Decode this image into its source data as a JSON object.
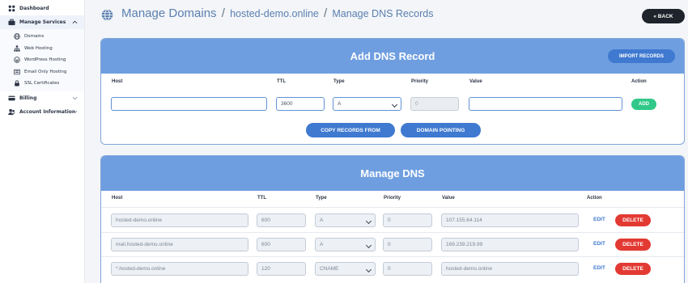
{
  "sidebar": {
    "dashboard": "Dashboard",
    "manage_services": "Manage Services",
    "sub_items": [
      "Domains",
      "Web Hosting",
      "WordPress Hosting",
      "Email Only Hosting",
      "SSL Certificates"
    ],
    "billing": "Billing",
    "account_information": "Account Information"
  },
  "header": {
    "title": "Manage Domains",
    "sep1": "/",
    "domain": "hosted-demo.online",
    "sep2": "/",
    "page": "Manage DNS Records",
    "back_label": "« BACK"
  },
  "add_card": {
    "title": "Add DNS Record",
    "import_label": "IMPORT RECORDS",
    "columns": [
      "Host",
      "TTL",
      "Type",
      "Priority",
      "Value",
      "Action"
    ],
    "ttl_value": "3600",
    "type_value": "A",
    "priority_value": "0",
    "add_label": "ADD",
    "copy_label": "COPY RECORDS FROM",
    "pointing_label": "DOMAIN POINTING"
  },
  "manage_card": {
    "title": "Manage DNS",
    "columns": [
      "Host",
      "TTL",
      "Type",
      "Priority",
      "Value",
      "Action"
    ],
    "edit_label": "EDIT",
    "delete_label": "DELETE",
    "records": [
      {
        "host": "hosted-demo.online",
        "ttl": "600",
        "type": "A",
        "priority": "0",
        "value": "107.155.64.114"
      },
      {
        "host": "mail.hosted-demo.online",
        "ttl": "600",
        "type": "A",
        "priority": "0",
        "value": "169.239.219.99"
      },
      {
        "host": "*.hosted-demo.online",
        "ttl": "120",
        "type": "CNAME",
        "priority": "0",
        "value": "hosted-demo.online"
      }
    ]
  },
  "colors": {
    "accent": "#6f9ee0",
    "primary_button": "#3f79d0",
    "add_green": "#31c889",
    "delete_red": "#e23a33",
    "back_dark": "#1f232b"
  },
  "icons": {
    "dashboard": "dashboard-grid-icon",
    "manage_services": "briefcase-icon",
    "domains": "globe-icon",
    "web_hosting": "sitemap-icon",
    "wordpress": "wordpress-icon",
    "email": "envelope-icon",
    "ssl": "lock-icon",
    "billing": "credit-card-icon",
    "account": "users-icon"
  }
}
